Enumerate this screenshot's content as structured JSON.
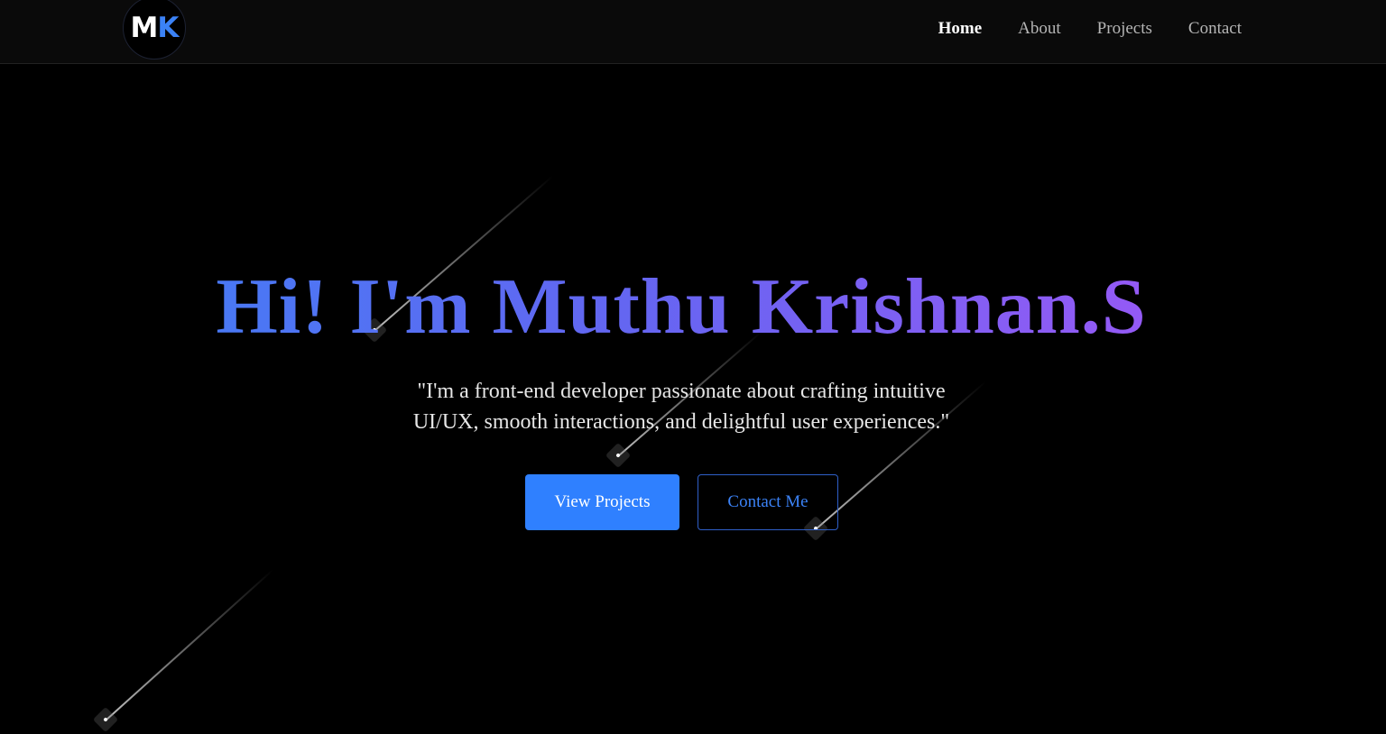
{
  "nav": {
    "logo": {
      "letter_1": "M",
      "letter_2": "K"
    },
    "links": [
      {
        "label": "Home",
        "active": true
      },
      {
        "label": "About",
        "active": false
      },
      {
        "label": "Projects",
        "active": false
      },
      {
        "label": "Contact",
        "active": false
      }
    ]
  },
  "hero": {
    "title": "Hi! I'm Muthu Krishnan.S",
    "subtitle": "\"I'm a front-end developer passionate about crafting intuitive UI/UX, smooth interactions, and delightful user experiences.\"",
    "primary_button": "View Projects",
    "secondary_button": "Contact Me"
  },
  "colors": {
    "background": "#000000",
    "navbar": "#0a0a0a",
    "accent_blue": "#2f80ff",
    "gradient_start": "#3b82f6",
    "gradient_end": "#a855f7",
    "text_muted": "#b5b5b5"
  }
}
